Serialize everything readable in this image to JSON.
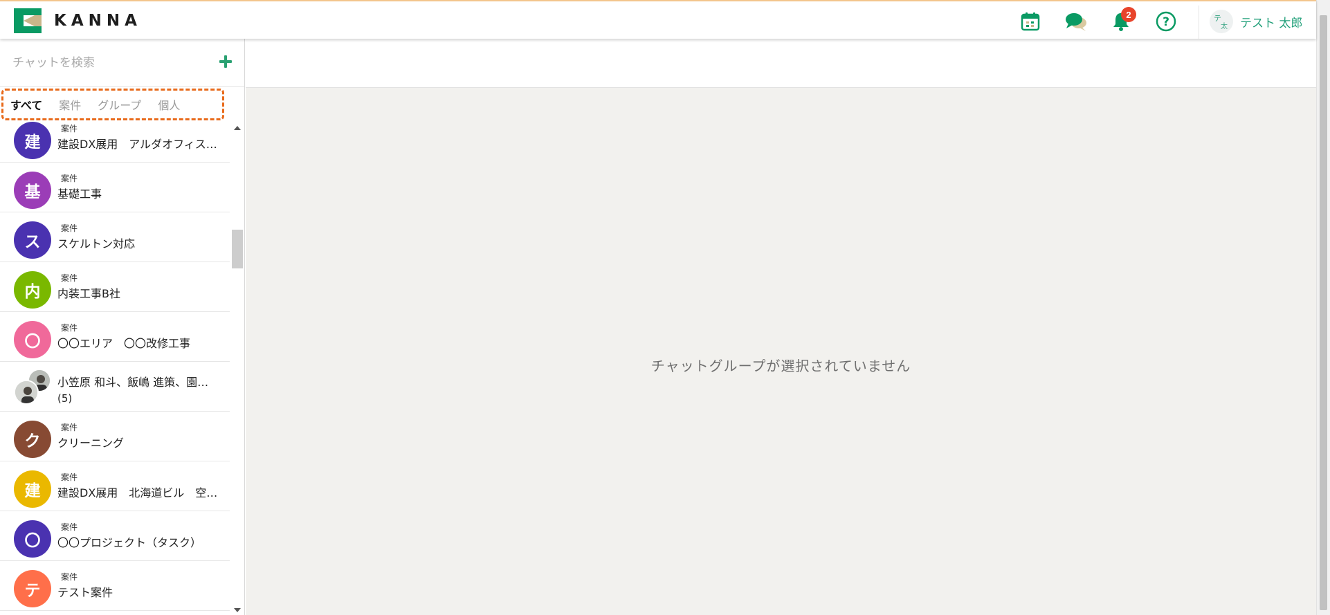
{
  "app": {
    "logo_text": "KANNA",
    "brand_green": "#0a9a63",
    "brand_tan": "#c9b68a"
  },
  "header": {
    "icons": [
      "calendar-icon",
      "chat-icon",
      "bell-icon",
      "help-icon"
    ],
    "notification_count": "2",
    "user": {
      "avatar_chars": [
        "テ",
        "太"
      ],
      "name": "テスト 太郎"
    }
  },
  "sidebar": {
    "search_placeholder": "チャットを検索",
    "tabs": [
      "すべて",
      "案件",
      "グループ",
      "個人"
    ],
    "active_tab": "すべて",
    "items": [
      {
        "avatar": "建",
        "color": "#4a32b0",
        "kind": "案件",
        "title": "建設DX展用　アルダオフィス…"
      },
      {
        "avatar": "基",
        "color": "#9b3db7",
        "kind": "案件",
        "title": "基礎工事"
      },
      {
        "avatar": "ス",
        "color": "#4a32b0",
        "kind": "案件",
        "title": "スケルトン対応"
      },
      {
        "avatar": "内",
        "color": "#7ab800",
        "kind": "案件",
        "title": "内装工事B社"
      },
      {
        "avatar": "〇",
        "color": "#f0699a",
        "kind": "案件",
        "title": "〇〇エリア　〇〇改修工事"
      },
      {
        "avatar": "",
        "color": "",
        "kind": "",
        "title": "小笠原 和斗、飯嶋 進策、園…",
        "count": "(5)"
      },
      {
        "avatar": "ク",
        "color": "#874a33",
        "kind": "案件",
        "title": "クリーニング"
      },
      {
        "avatar": "建",
        "color": "#eab800",
        "kind": "案件",
        "title": "建設DX展用　北海道ビル　空…"
      },
      {
        "avatar": "〇",
        "color": "#4a32b0",
        "kind": "案件",
        "title": "〇〇プロジェクト（タスク）"
      },
      {
        "avatar": "テ",
        "color": "#ff6f4a",
        "kind": "案件",
        "title": "テスト案件"
      }
    ]
  },
  "main": {
    "empty_message": "チャットグループが選択されていません"
  }
}
